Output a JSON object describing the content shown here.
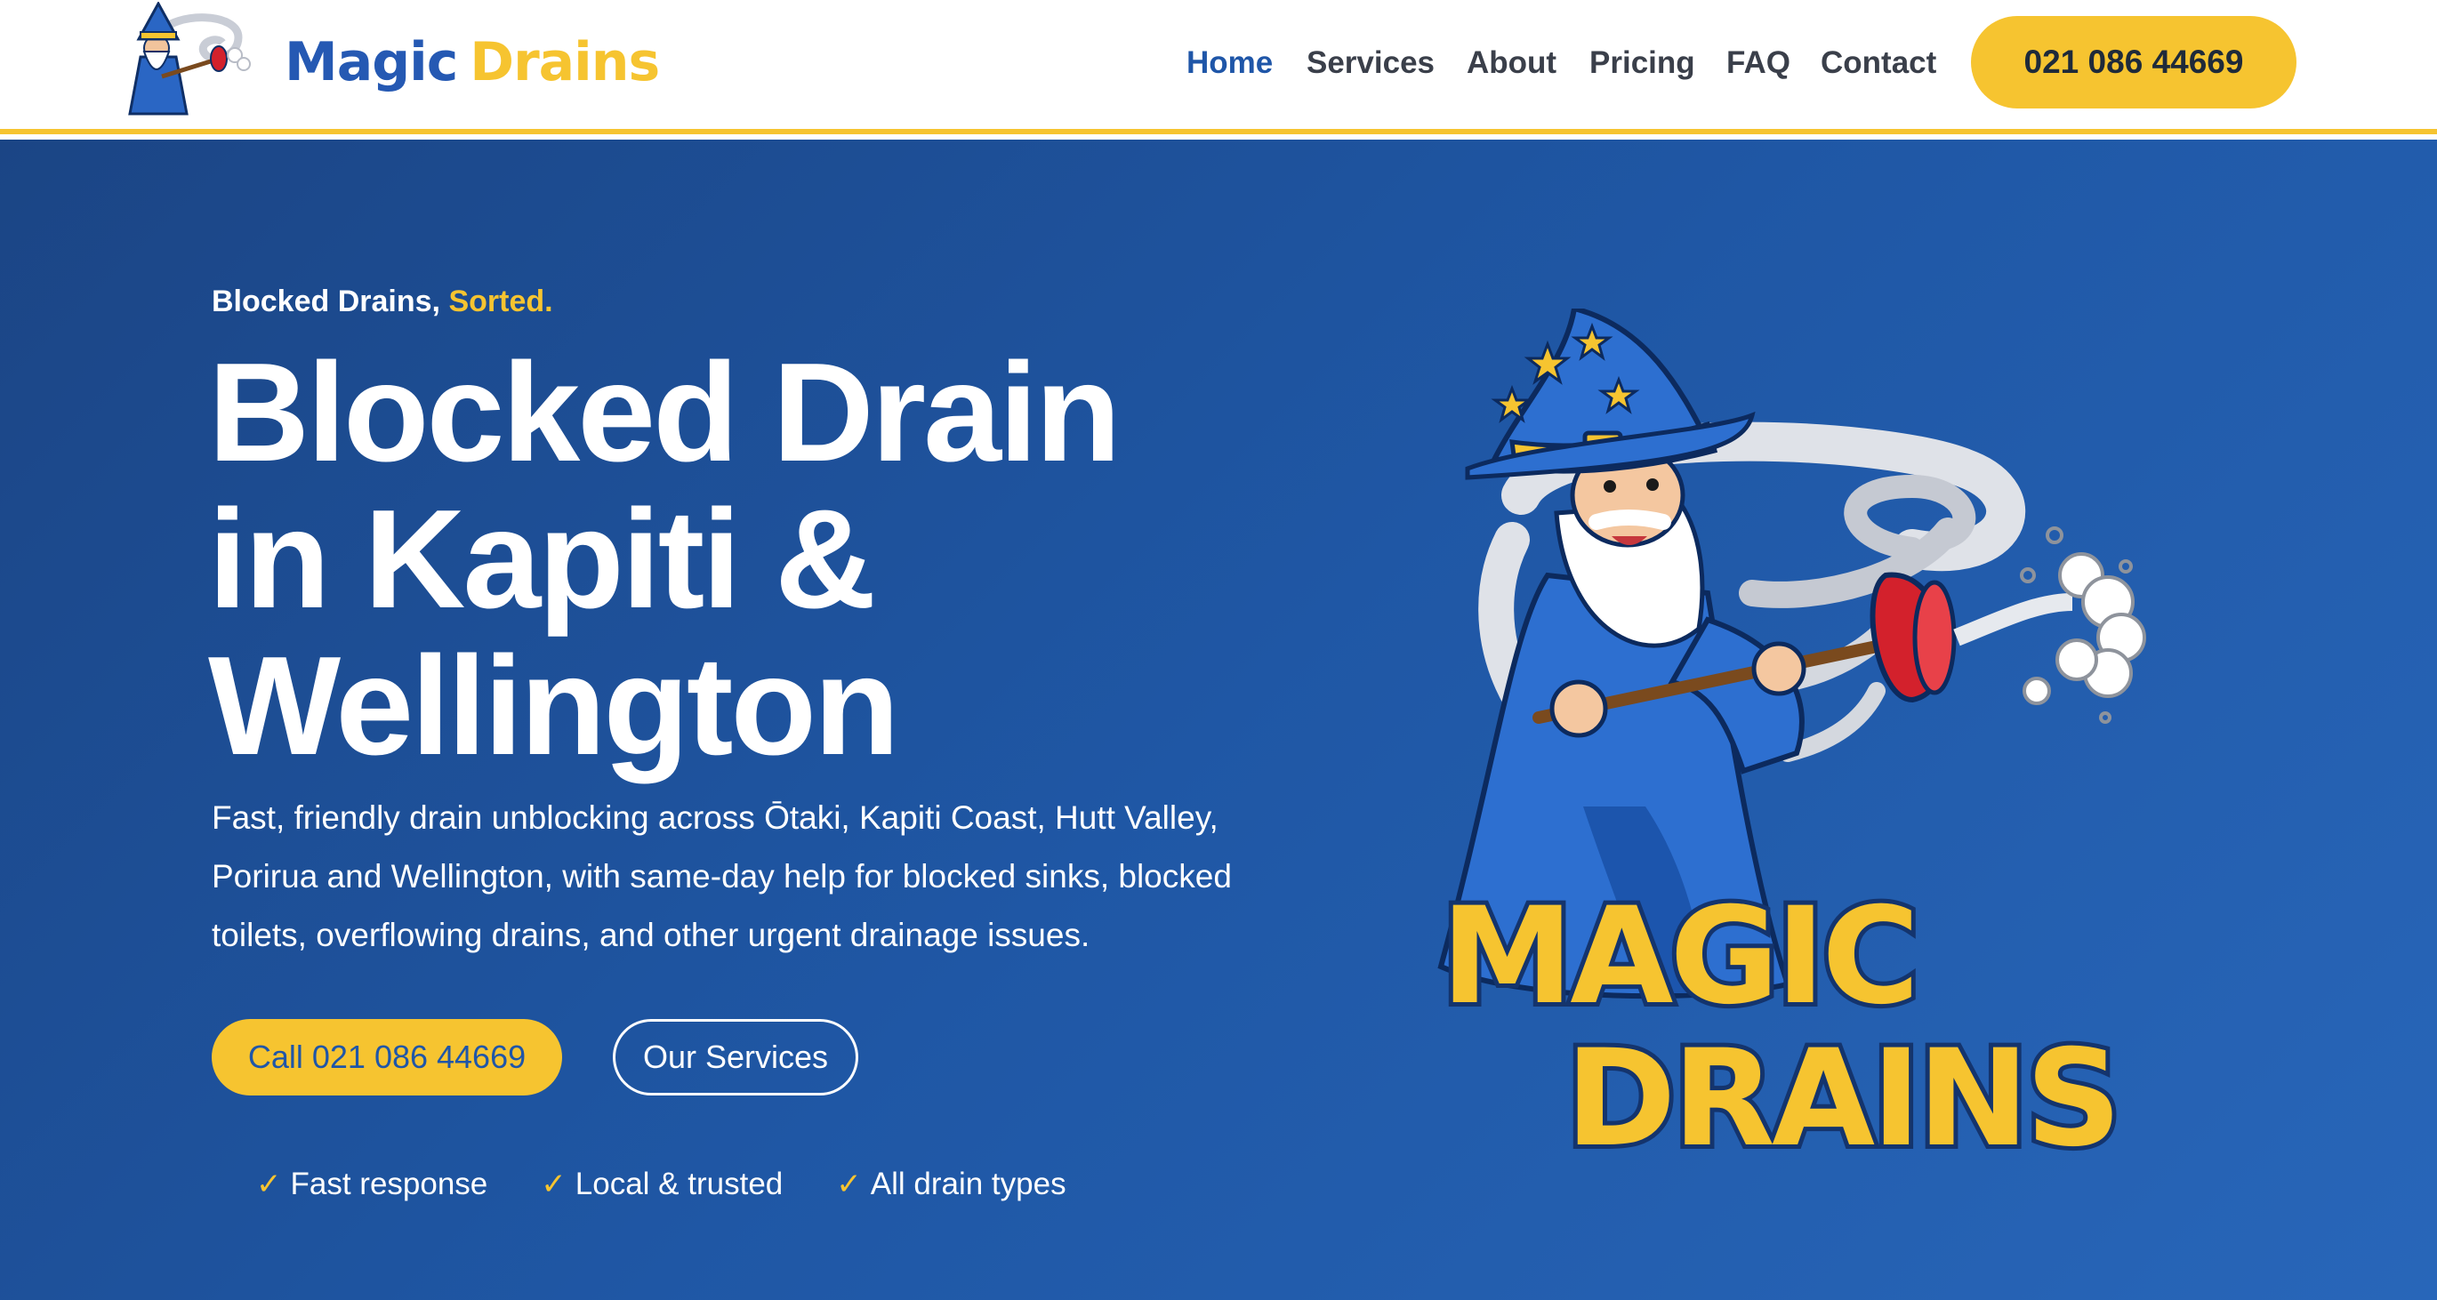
{
  "brand": {
    "name_part1": "Magic",
    "name_part2": "Drains",
    "logo_text": [
      "MAGIC",
      "DRAINS"
    ]
  },
  "nav": {
    "items": [
      {
        "label": "Home",
        "active": true
      },
      {
        "label": "Services",
        "active": false
      },
      {
        "label": "About",
        "active": false
      },
      {
        "label": "Pricing",
        "active": false
      },
      {
        "label": "FAQ",
        "active": false
      },
      {
        "label": "Contact",
        "active": false
      }
    ],
    "phone": "021 086 44669"
  },
  "hero": {
    "kicker_prefix": "Blocked Drains,",
    "kicker_accent": "Sorted.",
    "headline_lines": [
      "Blocked Drain",
      "in Kapiti &",
      "Wellington"
    ],
    "lead": "Fast, friendly drain unblocking across Ōtaki, Kapiti Coast, Hutt Valley, Porirua and Wellington, with same-day help for blocked sinks, blocked toilets, overflowing drains, and other urgent drainage issues.",
    "cta_primary": "Call 021 086 44669",
    "cta_secondary": "Our Services",
    "features": [
      "Fast response",
      "Local & trusted",
      "All drain types"
    ],
    "check_glyph": "✓"
  },
  "colors": {
    "brand_blue": "#2559b3",
    "accent_yellow": "#f6c430",
    "hero_bg": "#1f57a5",
    "nav_text": "#3a3f4a"
  },
  "icons": [
    "wizard-mascot-icon",
    "check-icon"
  ]
}
